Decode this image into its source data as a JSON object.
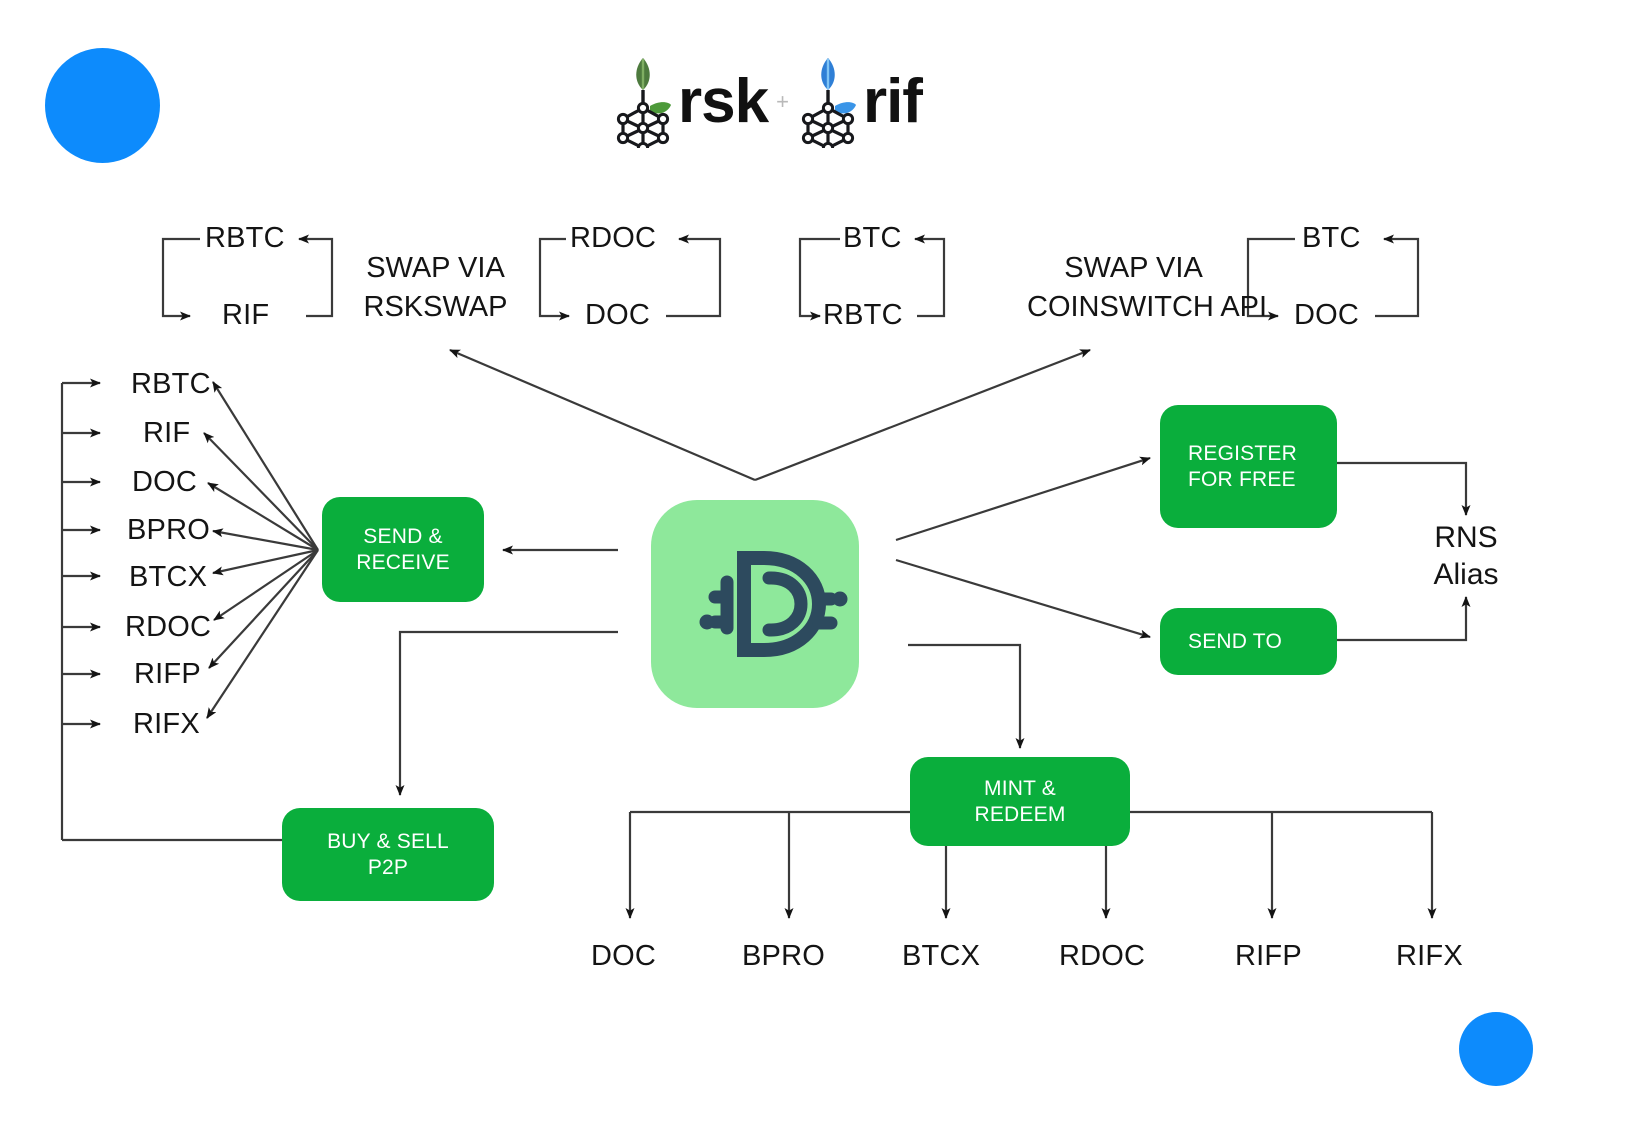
{
  "brand": {
    "left_word": "rsk",
    "plus": "+",
    "right_word": "rif",
    "left_mark_name": "rsk-hexagon-leaf-logo",
    "right_mark_name": "rif-hexagon-leaf-logo"
  },
  "decor": {
    "top_left_circle_color": "#0d8bfc",
    "bottom_right_circle_color": "#0d8bfc"
  },
  "center": {
    "app_icon_name": "defiant-wallet-d-icon",
    "tile_color": "#8ee89b",
    "glyph_color": "#2d4a5e"
  },
  "swap_groups": [
    {
      "name": "swap-via-rskswap-pair-1",
      "top_token": "RBTC",
      "bottom_token": "RIF"
    },
    {
      "name": "swap-via-rskswap-label",
      "label_line_1": "SWAP VIA",
      "label_line_2": "RSKSWAP"
    },
    {
      "name": "swap-via-rskswap-pair-2",
      "top_token": "RDOC",
      "bottom_token": "DOC"
    },
    {
      "name": "swap-via-coinswitch-pair-1",
      "top_token": "BTC",
      "bottom_token": "RBTC"
    },
    {
      "name": "swap-via-coinswitch-label",
      "label_line_1": "SWAP VIA",
      "label_line_2": "COINSWITCH API"
    },
    {
      "name": "swap-via-coinswitch-pair-2",
      "top_token": "BTC",
      "bottom_token": "DOC"
    }
  ],
  "send_receive": {
    "box_line_1": "SEND &",
    "box_line_2": "RECEIVE",
    "tokens": [
      "RBTC",
      "RIF",
      "DOC",
      "BPRO",
      "BTCX",
      "RDOC",
      "RIFP",
      "RIFX"
    ]
  },
  "buy_sell": {
    "box_line_1": "BUY & SELL",
    "box_line_2": "P2P"
  },
  "mint_redeem": {
    "box_line_1": "MINT &",
    "box_line_2": "REDEEM",
    "tokens": [
      "DOC",
      "BPRO",
      "BTCX",
      "RDOC",
      "RIFP",
      "RIFX"
    ]
  },
  "rns": {
    "register_box": "REGISTER FOR FREE",
    "register_line_1": "REGISTER",
    "register_line_2": "FOR FREE",
    "send_to_box": "SEND TO",
    "alias_line_1": "RNS",
    "alias_line_2": "Alias"
  },
  "colors": {
    "green": "#0aae3c",
    "blue": "#0d8bfc",
    "line": "#1a1a1a",
    "text": "#141414"
  }
}
